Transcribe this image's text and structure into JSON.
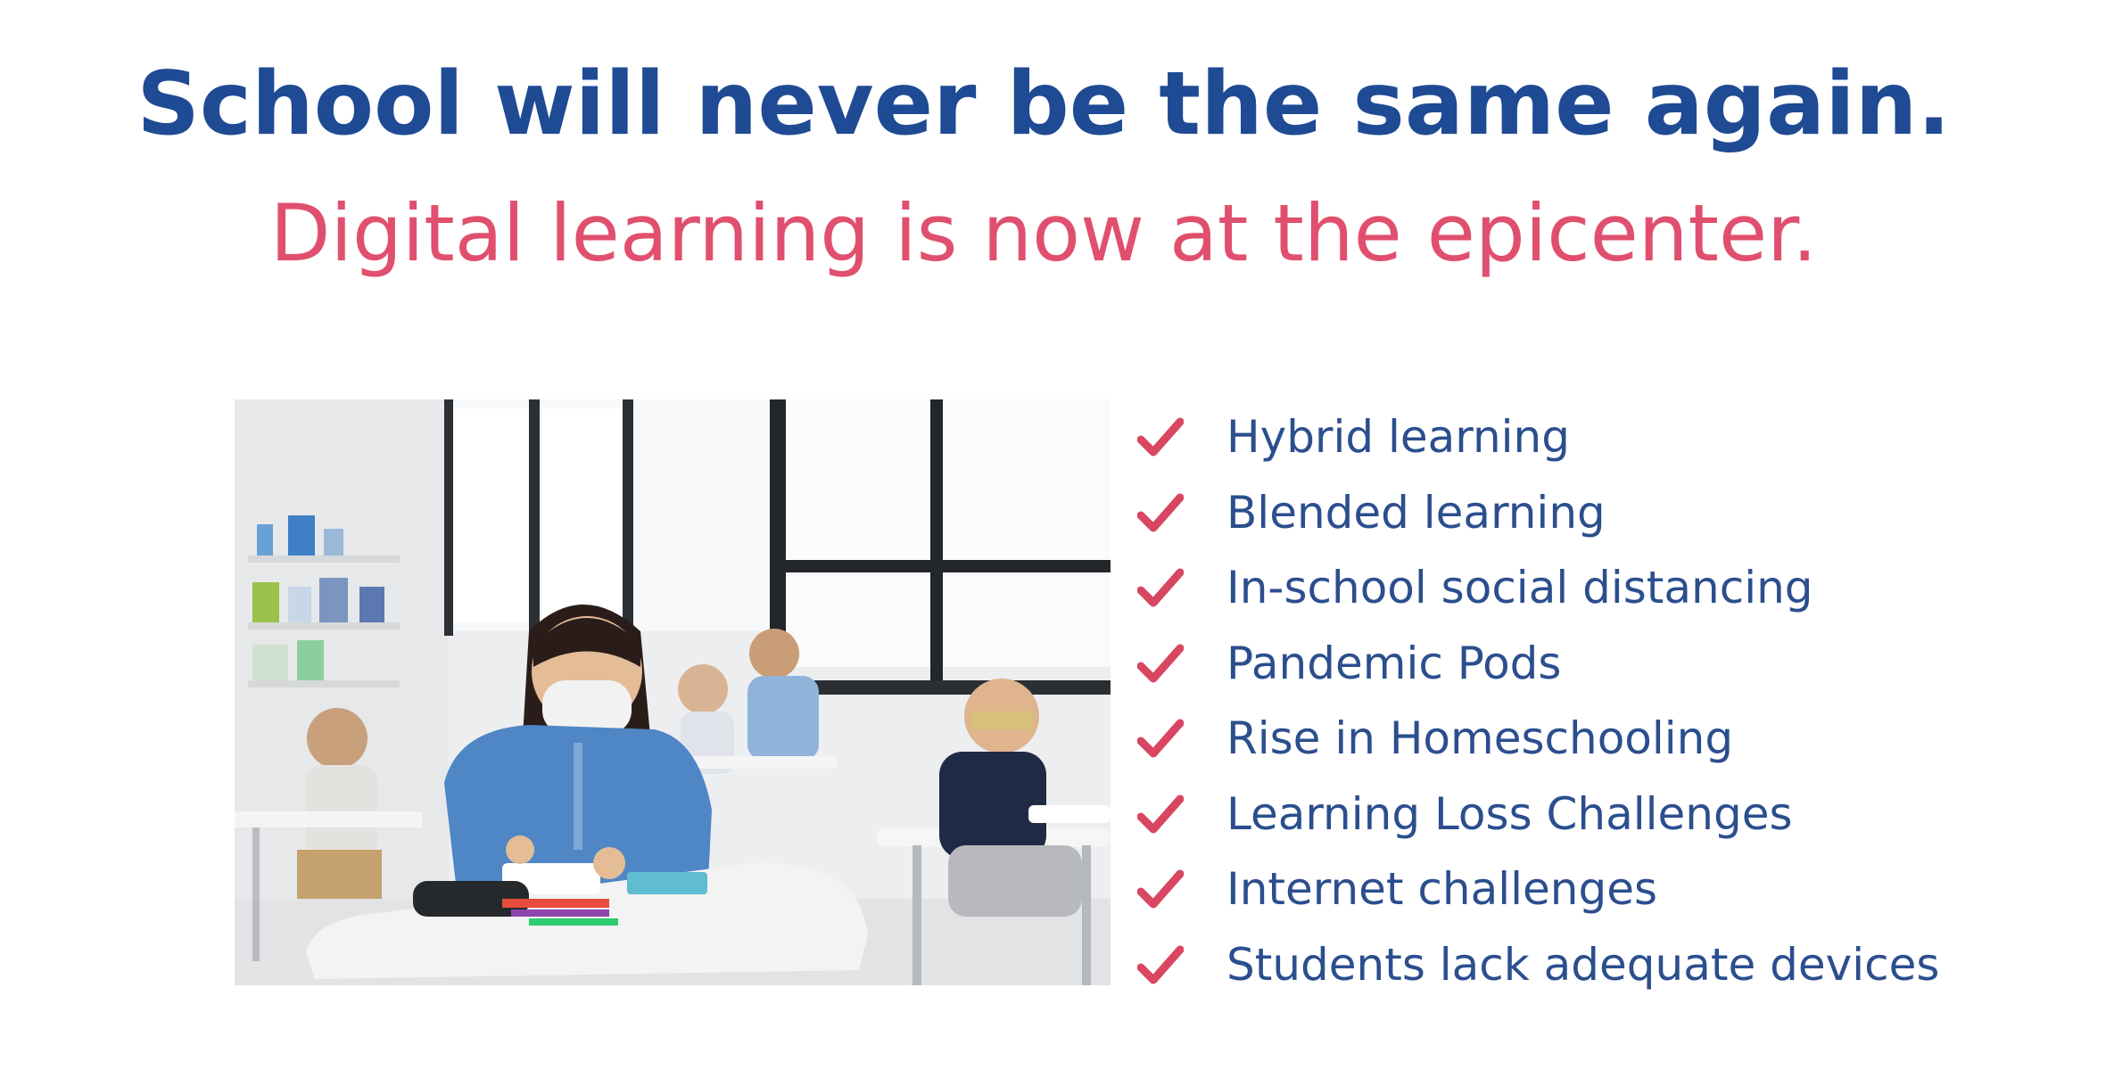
{
  "headline": "School will never be the same again.",
  "subheadline": "Digital learning is now at the epicenter.",
  "colors": {
    "headline": "#1f4a94",
    "subheadline": "#e0506e",
    "list_text": "#2b4e8e",
    "check": "#d94661"
  },
  "photo": {
    "icon": "classroom-photo"
  },
  "checklist": {
    "icon": "checkmark-icon",
    "items": [
      "Hybrid learning",
      "Blended learning",
      "In-school social distancing",
      "Pandemic Pods",
      "Rise in Homeschooling",
      "Learning Loss Challenges",
      "Internet challenges",
      "Students lack adequate devices"
    ]
  }
}
